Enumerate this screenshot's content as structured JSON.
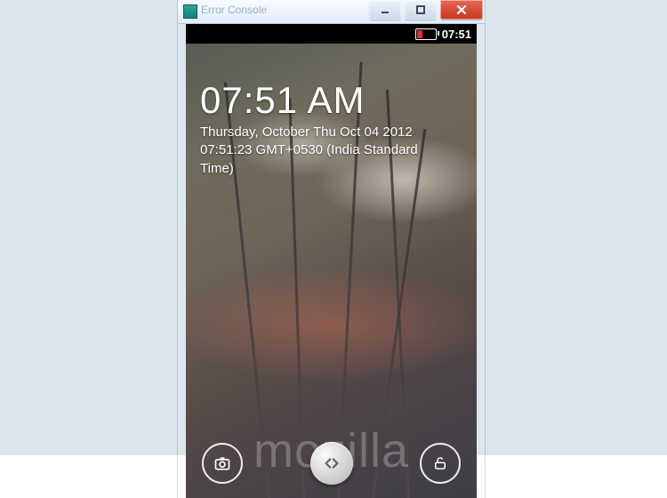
{
  "window": {
    "title": "Error Console"
  },
  "statusbar": {
    "time": "07:51"
  },
  "lockscreen": {
    "time": "07:51 AM",
    "date_line1": "Thursday, October Thu Oct 04 2012",
    "date_line2": "07:51:23 GMT+0530 (India Standard",
    "date_line3": "Time)"
  },
  "watermark": "mozilla"
}
